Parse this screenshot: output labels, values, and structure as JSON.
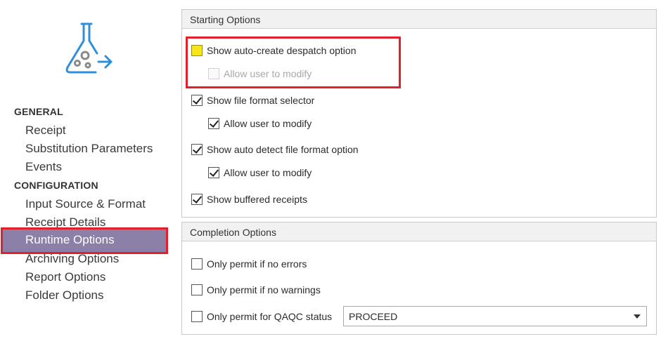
{
  "sidebar": {
    "general_heading": "GENERAL",
    "general_items": [
      "Receipt",
      "Substitution Parameters",
      "Events"
    ],
    "configuration_heading": "CONFIGURATION",
    "configuration_items": [
      "Input Source & Format",
      "Receipt Details",
      "Runtime Options",
      "Archiving Options",
      "Report Options",
      "Folder Options"
    ],
    "selected_item": "Runtime Options"
  },
  "starting_options": {
    "title": "Starting Options",
    "auto_create_despatch": {
      "label": "Show auto-create despatch option",
      "checked": false
    },
    "auto_create_allow_modify": {
      "label": "Allow user to modify",
      "checked": false,
      "enabled": false
    },
    "file_format_selector": {
      "label": "Show file format selector",
      "checked": true
    },
    "file_format_allow_modify": {
      "label": "Allow user to modify",
      "checked": true
    },
    "auto_detect_format": {
      "label": "Show auto detect file format option",
      "checked": true
    },
    "auto_detect_allow_modify": {
      "label": "Allow user to modify",
      "checked": true
    },
    "buffered_receipts": {
      "label": "Show buffered receipts",
      "checked": true
    }
  },
  "completion_options": {
    "title": "Completion Options",
    "no_errors": {
      "label": "Only permit if no errors",
      "checked": false
    },
    "no_warnings": {
      "label": "Only permit if no warnings",
      "checked": false
    },
    "qaqc_status": {
      "label": "Only permit for QAQC status",
      "checked": false
    },
    "qaqc_select_value": "PROCEED"
  },
  "colors": {
    "selected_nav_bg": "#8c80a8",
    "highlight_red": "#e0202a",
    "highlight_yellow": "#f5e619",
    "logo_blue": "#2f8fd8"
  },
  "icons": {
    "logo": "flask-arrow-icon",
    "dropdown": "chevron-down-icon"
  }
}
